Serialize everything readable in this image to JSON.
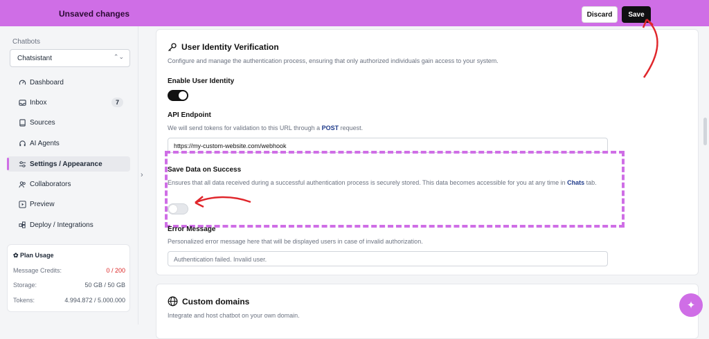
{
  "topbar": {
    "title": "Unsaved changes",
    "discard_label": "Discard",
    "save_label": "Save"
  },
  "sidebar": {
    "section_label": "Chatbots",
    "selected_bot": "Chatsistant",
    "items": [
      {
        "label": "Dashboard",
        "icon": "gauge-icon"
      },
      {
        "label": "Inbox",
        "icon": "inbox-icon",
        "badge": "7"
      },
      {
        "label": "Sources",
        "icon": "book-icon"
      },
      {
        "label": "AI Agents",
        "icon": "headset-icon"
      },
      {
        "label": "Settings / Appearance",
        "icon": "sliders-icon",
        "active": true
      },
      {
        "label": "Collaborators",
        "icon": "users-icon"
      },
      {
        "label": "Preview",
        "icon": "play-icon"
      },
      {
        "label": "Deploy / Integrations",
        "icon": "puzzle-icon"
      }
    ],
    "plan": {
      "title": "Plan Usage",
      "rows": [
        {
          "label": "Message Credits:",
          "value": "0 / 200"
        },
        {
          "label": "Storage:",
          "value": "50 GB / 50 GB"
        },
        {
          "label": "Tokens:",
          "value": "4.994.872 / 5.000.000"
        }
      ]
    }
  },
  "identity": {
    "title": "User Identity Verification",
    "description": "Configure and manage the authentication process, ensuring that only authorized individuals gain access to your system.",
    "enable_label": "Enable User Identity",
    "enable_on": true,
    "api_label": "API Endpoint",
    "api_desc_pre": "We will send tokens for validation to this URL through a ",
    "api_desc_bold": "POST",
    "api_desc_post": " request.",
    "api_value": "https://my-custom-website.com/webhook",
    "save_label": "Save Data on Success",
    "save_desc_pre": "Ensures that all data received during a successful authentication process is securely stored. This data becomes accessible for you at any time in ",
    "save_desc_bold": "Chats",
    "save_desc_post": " tab.",
    "save_on": false,
    "error_label": "Error Message",
    "error_desc": "Personalized error message here that will be displayed users in case of invalid authorization.",
    "error_value": "Authentication failed. Invalid user."
  },
  "domains": {
    "title": "Custom domains",
    "description": "Integrate and host chatbot on your own domain."
  },
  "colors": {
    "accent": "#cf6ee6",
    "annotation": "#e0262b"
  }
}
